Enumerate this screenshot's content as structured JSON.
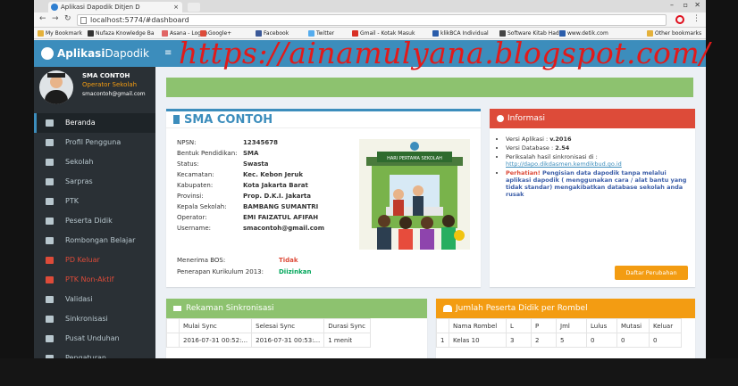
{
  "browser": {
    "tab_title": "Aplikasi Dapodik Ditjen D",
    "tab_close": "×",
    "url": "localhost:5774/#dashboard",
    "bookmarks": [
      {
        "label": "My Bookmark",
        "color": "#e4b13b"
      },
      {
        "label": "Nufaza Knowledge Ba",
        "color": "#333333"
      },
      {
        "label": "Asana - Log In",
        "color": "#e06464"
      },
      {
        "label": "Google+",
        "color": "#dd4b39"
      },
      {
        "label": "Facebook",
        "color": "#3b5998"
      },
      {
        "label": "Twitter",
        "color": "#55acee"
      },
      {
        "label": "Gmail - Kotak Masuk",
        "color": "#d93025"
      },
      {
        "label": "klikBCA Individual",
        "color": "#2a5caa"
      },
      {
        "label": "Software Kitab Hadits",
        "color": "#444444"
      },
      {
        "label": "www.detik.com",
        "color": "#2a5caa"
      }
    ],
    "other_bookmarks": "Other bookmarks"
  },
  "app": {
    "brand_bold": "Aplikasi",
    "brand_rest": "Dapodik",
    "user": {
      "name": "SMA CONTOH",
      "role": "Operator Sekolah",
      "email": "smacontoh@gmail.com"
    },
    "menu": [
      {
        "label": "Beranda",
        "active": true,
        "red": false
      },
      {
        "label": "Profil Pengguna",
        "active": false,
        "red": false
      },
      {
        "label": "Sekolah",
        "active": false,
        "red": false
      },
      {
        "label": "Sarpras",
        "active": false,
        "red": false
      },
      {
        "label": "PTK",
        "active": false,
        "red": false
      },
      {
        "label": "Peserta Didik",
        "active": false,
        "red": false
      },
      {
        "label": "Rombongan Belajar",
        "active": false,
        "red": false
      },
      {
        "label": "PD Keluar",
        "active": false,
        "red": true
      },
      {
        "label": "PTK Non-Aktif",
        "active": false,
        "red": true
      },
      {
        "label": "Validasi",
        "active": false,
        "red": false
      },
      {
        "label": "Sinkronisasi",
        "active": false,
        "red": false
      },
      {
        "label": "Pusat Unduhan",
        "active": false,
        "red": false
      },
      {
        "label": "Pengaturan",
        "active": false,
        "red": false
      }
    ],
    "hamburger": "≡"
  },
  "school": {
    "title": "SMA CONTOH",
    "fields": [
      {
        "label": "NPSN:",
        "value": "12345678"
      },
      {
        "label": "Bentuk Pendidikan:",
        "value": "SMA"
      },
      {
        "label": "Status:",
        "value": "Swasta"
      },
      {
        "label": "Kecamatan:",
        "value": "Kec. Kebon Jeruk"
      },
      {
        "label": "Kabupaten:",
        "value": "Kota Jakarta Barat"
      },
      {
        "label": "Provinsi:",
        "value": "Prop. D.K.I. Jakarta"
      },
      {
        "label": "Kepala Sekolah:",
        "value": "BAMBANG SUMANTRI"
      },
      {
        "label": "Operator:",
        "value": "EMI FAIZATUL AFIFAH"
      },
      {
        "label": "Username:",
        "value": "smacontoh@gmail.com"
      }
    ],
    "bos_label": "Menerima BOS:",
    "bos_value": "Tidak",
    "kurikulum_label": "Penerapan Kurikulum 2013:",
    "kurikulum_value": "Diizinkan",
    "illustration_sign": "HARI PERTAMA SEKOLAH"
  },
  "informasi": {
    "title": "Informasi",
    "versi_aplikasi_label": "Versi Aplikasi : ",
    "versi_aplikasi": "v.2016",
    "versi_database_label": "Versi Database : ",
    "versi_database": "2.54",
    "perisai_text": "Periksalah hasil sinkronisasi di :",
    "link": "http://dapo.dikdasmen.kemdikbud.go.id",
    "warning_prefix": "Perhatian!",
    "warning_text": " Pengisian data dapodik tanpa melalui aplikasi dapodik ( menggunakan cara / alat bantu yang tidak standar) mengakibatkan database sekolah anda rusak",
    "button": "Daftar Perubahan"
  },
  "sync": {
    "title": "Rekaman Sinkronisasi",
    "headers": [
      "",
      "Mulai Sync",
      "Selesai Sync",
      "Durasi Sync"
    ],
    "rows": [
      [
        "",
        "2016-07-31 00:52:...",
        "2016-07-31 00:53:...",
        "1 menit"
      ]
    ]
  },
  "rombel": {
    "title": "Jumlah Peserta Didik per Rombel",
    "headers": [
      "",
      "Nama Rombel",
      "L",
      "P",
      "Jml",
      "Lulus",
      "Mutasi",
      "Keluar"
    ],
    "rows": [
      [
        "1",
        "Kelas 10",
        "3",
        "2",
        "5",
        "0",
        "0",
        "0"
      ]
    ]
  },
  "watermark": "https://ainamulyana.blogspot.com/"
}
